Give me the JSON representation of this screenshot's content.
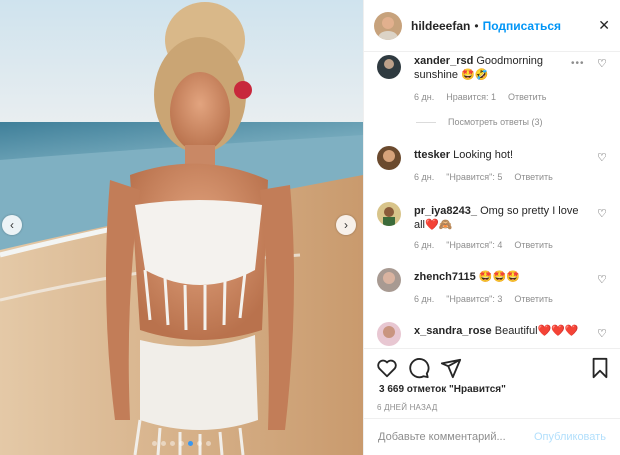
{
  "header": {
    "username": "hildeeefan",
    "separator": "•",
    "follow_label": "Подписаться",
    "close_glyph": "✕"
  },
  "media": {
    "prev_glyph": "‹",
    "next_glyph": "›",
    "slide_count": 7,
    "active_slide": 4
  },
  "comments": [
    {
      "user": "xander_rsd",
      "text": "Goodmorning sunshine 🤩🤣",
      "age": "6 дн.",
      "likes": "Нравится: 1",
      "reply": "Ответить",
      "replies": "Посмотреть ответы (3)"
    },
    {
      "user": "ttesker",
      "text": "Looking hot!",
      "age": "6 дн.",
      "likes": "\"Нравится\": 5",
      "reply": "Ответить"
    },
    {
      "user": "pr_iya8243_",
      "text": "Omg so pretty I love all❤️🙈",
      "age": "6 дн.",
      "likes": "\"Нравится\": 4",
      "reply": "Ответить"
    },
    {
      "user": "zhench7115",
      "text": "🤩🤩🤩",
      "age": "6 дн.",
      "likes": "\"Нравится\": 3",
      "reply": "Ответить"
    },
    {
      "user": "x_sandra_rose",
      "text": "Beautiful❤️❤️❤️"
    }
  ],
  "more_glyph": "•••",
  "heart_glyph": "♡",
  "footer": {
    "likes": "3 669 отметок \"Нравится\"",
    "time": "6 ДНЕЙ НАЗАД",
    "comment_placeholder": "Добавьте комментарий...",
    "publish_label": "Опубликовать"
  },
  "colors": {
    "accent": "#0095f6",
    "muted": "#8e8e8e",
    "text": "#262626"
  }
}
